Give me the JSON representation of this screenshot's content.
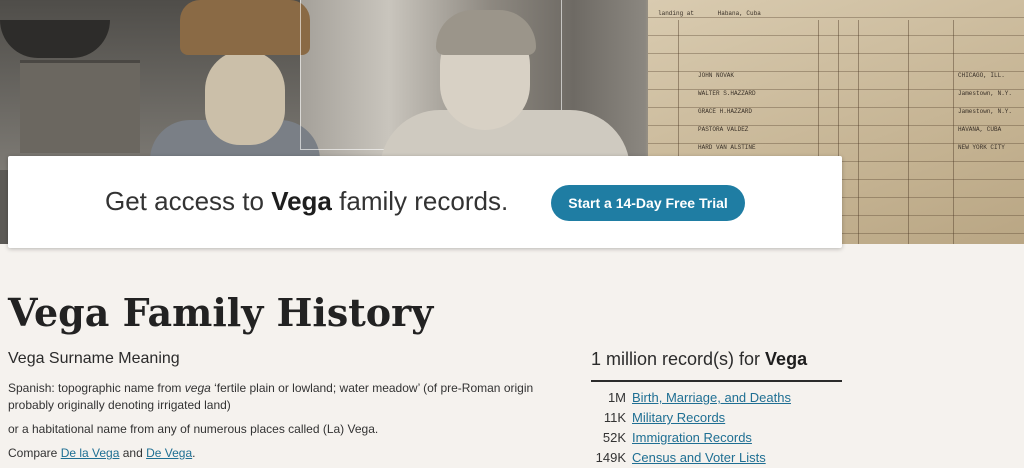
{
  "banner": {
    "text_before": "Get access to ",
    "surname": "Vega",
    "text_after": " family records.",
    "cta_label": "Start a 14-Day Free Trial"
  },
  "page_title": "Vega Family History",
  "meaning": {
    "heading": "Vega Surname Meaning",
    "para1_before": "Spanish: topographic name from ",
    "para1_italic": "vega",
    "para1_after": " ‘fertile plain or lowland; water meadow’ (of pre-Roman origin probably originally denoting irrigated land)",
    "para2": "or a habitational name from any of numerous places called (La) Vega.",
    "compare_prefix": "Compare ",
    "compare_link1": "De la Vega",
    "compare_and": " and ",
    "compare_link2": "De Vega",
    "compare_suffix": "."
  },
  "records": {
    "title_before": "1 million record(s) for ",
    "title_surname": "Vega",
    "items": [
      {
        "count": "1M",
        "label": "Birth, Marriage, and Deaths"
      },
      {
        "count": "11K",
        "label": "Military Records"
      },
      {
        "count": "52K",
        "label": "Immigration Records"
      },
      {
        "count": "149K",
        "label": "Census and Voter Lists"
      }
    ]
  },
  "hero_document": {
    "landing_text": "landing at",
    "landing_place": "Habana, Cuba",
    "names": [
      "JOHN NOVAK",
      "WALTER S.HAZZARD",
      "GRACE H.HAZZARD",
      "PASTORA VALDEZ",
      "HARD VAN ALSTINE"
    ],
    "destinations": [
      "CHICAGO, ILL.",
      "Jamestown, N.Y.",
      "Jamestown, N.Y.",
      "HAVANA, CUBA",
      "NEW YORK CITY"
    ]
  },
  "colors": {
    "accent": "#1f7da3",
    "link": "#1f6f93",
    "background": "#f5f2ee"
  }
}
